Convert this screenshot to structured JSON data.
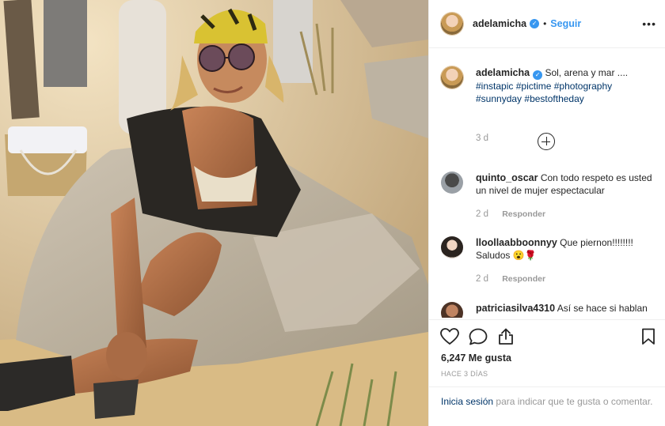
{
  "post": {
    "author": "adelamicha",
    "follow_label": "Seguir",
    "more_label": "•••"
  },
  "caption": {
    "author": "adelamicha",
    "text": "Sol, arena y mar ....",
    "hashtags": [
      "#instapic",
      "#pictime",
      "#photography",
      "#sunnyday",
      "#bestoftheday"
    ],
    "time": "3 d"
  },
  "comments": [
    {
      "author": "quinto_oscar",
      "text": "Con todo respeto es usted un nivel de mujer espectacular",
      "time": "2 d",
      "reply_label": "Responder"
    },
    {
      "author": "lloollaabboonnyy",
      "text": "Que piernon!!!!!!!! Saludos 😮🌹",
      "time": "2 d",
      "reply_label": "Responder"
    },
    {
      "author": "patriciasilva4310",
      "text": "Así se hace si hablan",
      "time": "",
      "reply_label": ""
    }
  ],
  "likes": {
    "text": "6,247 Me gusta"
  },
  "posted_ago": "HACE 3 DÍAS",
  "login_prompt": {
    "link": "Inicia sesión",
    "rest": "para indicar que te gusta o comentar."
  },
  "icons": {
    "like": "heart-icon",
    "comment": "comment-icon",
    "share": "share-icon",
    "save": "bookmark-icon",
    "load_more": "plus-circle-icon",
    "verified": "verified-badge-icon"
  },
  "colors": {
    "link": "#3897f0",
    "tag": "#003569",
    "muted": "#999999",
    "text": "#262626"
  }
}
